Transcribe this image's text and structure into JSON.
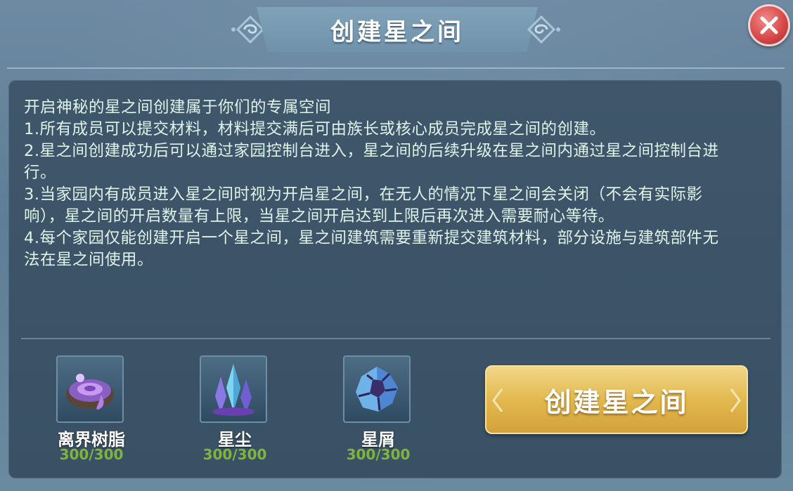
{
  "header": {
    "title": "创建星之间",
    "close_icon": "close-icon"
  },
  "description": {
    "intro": "开启神秘的星之间创建属于你们的专属空间",
    "rule_1": "1.所有成员可以提交材料，材料提交满后可由族长或核心成员完成星之间的创建。",
    "rule_2": "2.星之间创建成功后可以通过家园控制台进入，星之间的后续升级在星之间内通过星之间控制台进行。",
    "rule_3": "3.当家园内有成员进入星之间时视为开启星之间，在无人的情况下星之间会关闭（不会有实际影响），星之间的开启数量有上限，当星之间开启达到上限后再次进入需要耐心等待。",
    "rule_4": "4.每个家园仅能创建开启一个星之间，星之间建筑需要重新提交建筑材料，部分设施与建筑部件无法在星之间使用。"
  },
  "materials": [
    {
      "name": "离界树脂",
      "count": "300/300",
      "icon": "resin-icon"
    },
    {
      "name": "星尘",
      "count": "300/300",
      "icon": "crystal-icon"
    },
    {
      "name": "星屑",
      "count": "300/300",
      "icon": "star-fragment-icon"
    }
  ],
  "create_button": {
    "label": "创建星之间"
  },
  "colors": {
    "panel": "#3f566b",
    "text": "#dff3e8",
    "count_green": "#7fb53a",
    "button_gold": "#e2b94e",
    "close_red": "#d94a4a"
  }
}
